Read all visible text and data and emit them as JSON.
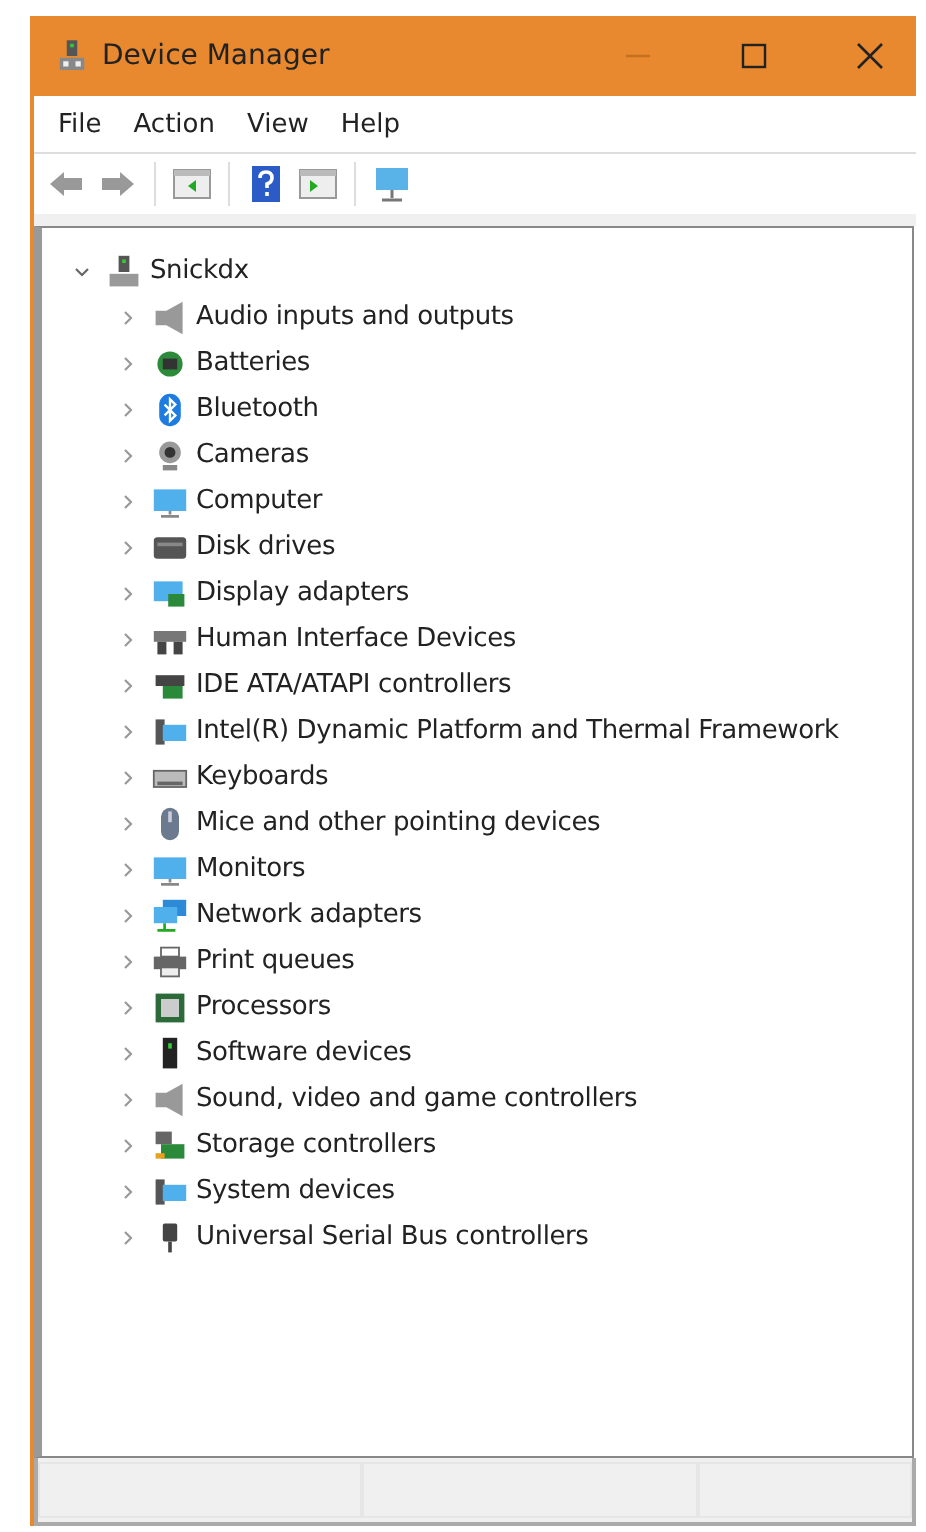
{
  "window": {
    "title": "Device Manager"
  },
  "menu": [
    "File",
    "Action",
    "View",
    "Help"
  ],
  "tree": {
    "label": "Snickdx",
    "expanded": true,
    "children": [
      {
        "label": "Audio inputs and outputs",
        "expanded": false
      },
      {
        "label": "Batteries",
        "expanded": false
      },
      {
        "label": "Bluetooth",
        "expanded": false
      },
      {
        "label": "Cameras",
        "expanded": false
      },
      {
        "label": "Computer",
        "expanded": false
      },
      {
        "label": "Disk drives",
        "expanded": false
      },
      {
        "label": "Display adapters",
        "expanded": false
      },
      {
        "label": "Human Interface Devices",
        "expanded": false
      },
      {
        "label": "IDE ATA/ATAPI controllers",
        "expanded": false
      },
      {
        "label": "Intel(R) Dynamic Platform and Thermal Framework",
        "expanded": false
      },
      {
        "label": "Keyboards",
        "expanded": false
      },
      {
        "label": "Mice and other pointing devices",
        "expanded": false
      },
      {
        "label": "Monitors",
        "expanded": false
      },
      {
        "label": "Network adapters",
        "expanded": false
      },
      {
        "label": "Print queues",
        "expanded": false
      },
      {
        "label": "Processors",
        "expanded": false
      },
      {
        "label": "Software devices",
        "expanded": false
      },
      {
        "label": "Sound, video and game controllers",
        "expanded": false
      },
      {
        "label": "Storage controllers",
        "expanded": false
      },
      {
        "label": "System devices",
        "expanded": false
      },
      {
        "label": "Universal Serial Bus controllers",
        "expanded": false
      }
    ]
  }
}
